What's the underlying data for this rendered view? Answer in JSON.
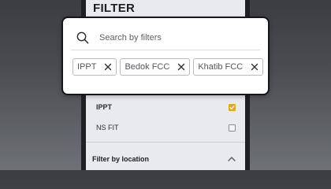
{
  "panel": {
    "title": "FILTER",
    "options": [
      {
        "label": "IPPT",
        "checked": true
      },
      {
        "label": "NS FIT",
        "checked": false
      }
    ],
    "section": {
      "label": "Filter by location",
      "icon": "chevron-up-icon"
    }
  },
  "search": {
    "placeholder": "Search by filters",
    "value": "",
    "icon": "search-icon"
  },
  "chips": [
    {
      "label": "IPPT",
      "icon": "close-icon"
    },
    {
      "label": "Bedok FCC",
      "icon": "close-icon"
    },
    {
      "label": "Khatib FCC",
      "icon": "close-icon"
    }
  ],
  "colors": {
    "accent": "#e0a81e",
    "card_border": "#15161a",
    "panel_bg": "#e9eaed"
  }
}
